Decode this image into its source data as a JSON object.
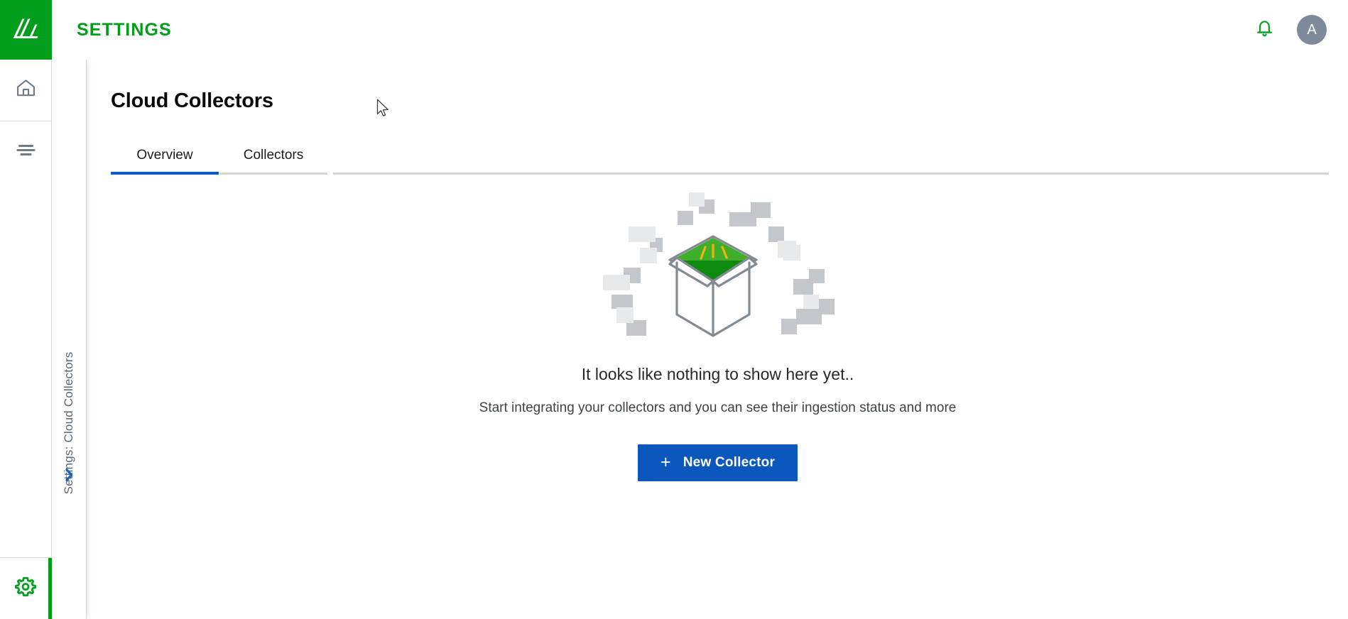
{
  "brand": {
    "logo_icon": "sumologic-logo-icon",
    "green": "#009E1A",
    "blue": "#0B57BE",
    "gray": "#7D8A99"
  },
  "header": {
    "title": "SETTINGS",
    "notifications_icon": "bell-icon",
    "avatar_initial": "A"
  },
  "rail": {
    "items": [
      {
        "icon": "home-icon",
        "name": "home"
      },
      {
        "icon": "list-lines-icon",
        "name": "library"
      }
    ],
    "bottom_item": {
      "icon": "gear-icon",
      "name": "settings",
      "active": true
    }
  },
  "subrail": {
    "vertical_label": "Settings:  Cloud Collectors",
    "expand_icon": "chevron-right-icon"
  },
  "main": {
    "page_title": "Cloud Collectors",
    "tabs": [
      {
        "label": "Overview",
        "active": true
      },
      {
        "label": "Collectors",
        "active": false
      }
    ],
    "empty_state": {
      "illustration": "open-box-sparkle-illustration",
      "title": "It looks like nothing to show here yet..",
      "subtitle": "Start integrating your collectors and you can see their ingestion status and more",
      "button": {
        "label": "New Collector",
        "plus_icon": "plus-icon",
        "plus_glyph": "+"
      }
    }
  },
  "cursor": {
    "icon": "mouse-pointer-icon"
  }
}
